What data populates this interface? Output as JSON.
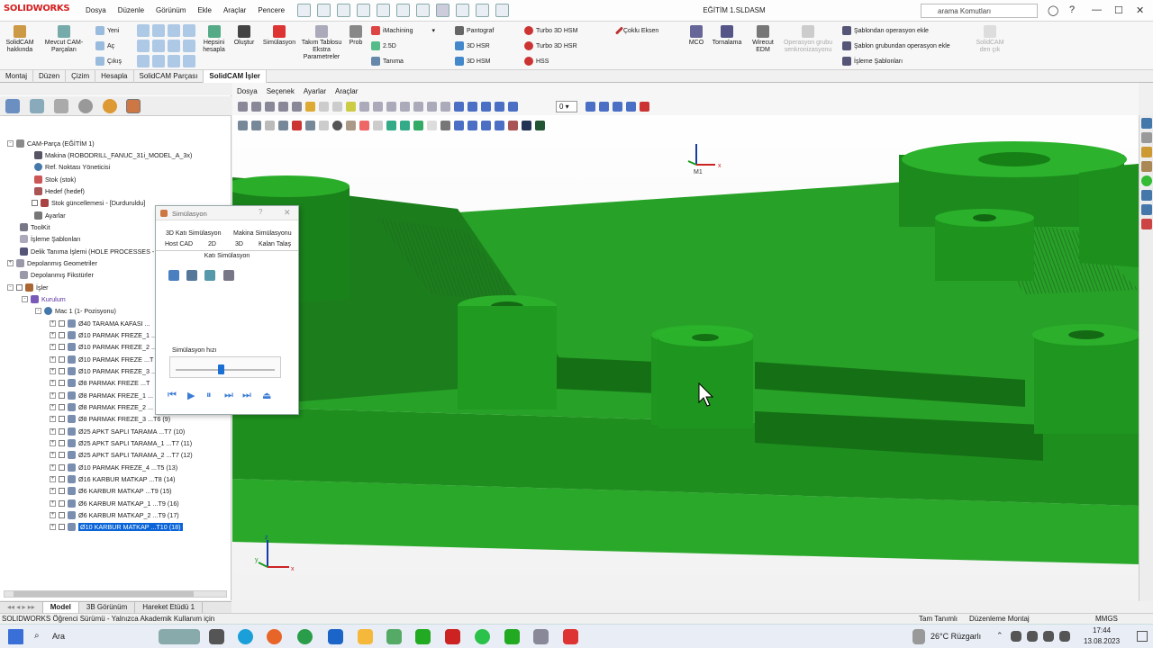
{
  "app": {
    "logo": "SOLIDWORKS",
    "doc_title": "EĞİTİM 1.SLDASM"
  },
  "menu": [
    "Dosya",
    "Düzenle",
    "Görünüm",
    "Ekle",
    "Araçlar",
    "Pencere"
  ],
  "search": {
    "placeholder": "arama Komutları"
  },
  "ribbon": {
    "solidcam_about": "SolidCAM hakkında",
    "mevcut": "Mevcut CAM-Parçaları",
    "yeni": "Yeni",
    "ac": "Aç",
    "cikis": "Çıkış",
    "hepsini": "Hepsini hesapla",
    "olustur": "Oluştur",
    "simulasyon": "Simülasyon",
    "takim": "Takım Tablosu Ekstra Parametreler",
    "prob": "Prob",
    "imachining": "iMachining",
    "d25": "2.5D",
    "tanima": "Tanıma",
    "pantograf": "Pantograf",
    "hsr3d": "3D HSR",
    "hsm3d": "3D HSM",
    "turbo_hsm": "Turbo 3D HSM",
    "turbo_hsr": "Turbo 3D HSR",
    "hss": "HSS",
    "coklu": "Çoklu Eksen",
    "mco": "MCO",
    "tornalama": "Tornalama",
    "wirecut": "Wirecut EDM",
    "sync": "Operasyon grubu senkronizasyonu",
    "sablondan": "Şablondan operasyon ekle",
    "sablon_grup": "Şablon grubundan operasyon ekle",
    "isleme_sablon": "İşleme Şablonları",
    "solidcam_ek": "SolidCAM den çık"
  },
  "tabs": [
    "Montaj",
    "Düzen",
    "Çizim",
    "Hesapla",
    "SolidCAM Parçası",
    "SolidCAM İşler"
  ],
  "view_menu": [
    "Dosya",
    "Seçenek",
    "Ayarlar",
    "Araçlar"
  ],
  "view_num": "0",
  "tree": [
    "CAM-Parça (EĞİTİM 1)",
    "Makina (ROBODRILL_FANUC_31i_MODEL_A_3x)",
    "Ref. Noktası Yöneticisi",
    "Stok (stok)",
    "Hedef (hedef)",
    "Stok güncellemesi - [Durduruldu]",
    "Ayarlar",
    "ToolKit",
    "İşleme Şablonları",
    "Delik Tanıma İşlemi (HOLE PROCESSES - SO",
    "Depolanmış Geometriler",
    "Depolanmış Fikstürler",
    "İşler",
    "Kurulum",
    "Mac 1 (1- Pozisyonu)",
    "Ø40 TARAMA KAFASI ...",
    "Ø10 PARMAK FREZE_1 ...",
    "Ø10 PARMAK FREZE_2 ...",
    "Ø10 PARMAK FREZE ...T",
    "Ø10 PARMAK FREZE_3 ...",
    "Ø8 PARMAK FREZE ...T",
    "Ø8 PARMAK FREZE_1 ...",
    "Ø8 PARMAK FREZE_2 ...",
    "Ø8 PARMAK FREZE_3 ...T6 (9)",
    "Ø25 APKT SAPLI TARAMA ...T7 (10)",
    "Ø25 APKT SAPLI TARAMA_1 ...T7 (11)",
    "Ø25 APKT SAPLI TARAMA_2 ...T7 (12)",
    "Ø10 PARMAK FREZE_4 ...T5 (13)",
    "Ø16 KARBUR MATKAP ...T8 (14)",
    "Ø6 KARBUR MATKAP ...T9 (15)",
    "Ø6 KARBUR MATKAP_1 ...T9 (16)",
    "Ø6 KARBUR MATKAP_2 ...T9 (17)",
    "Ø10 KARBUR MATKAP ...T10 (18)"
  ],
  "bottom_tabs": [
    "Model",
    "3B Görünüm",
    "Hareket Etüdü 1"
  ],
  "status": {
    "left": "SOLIDWORKS Öğrenci Sürümü - Yalnızca Akademik Kullanım için",
    "mid1": "Tam Tanımlı",
    "mid2": "Düzenleme Montaj",
    "units": "MMGS"
  },
  "dialog": {
    "title": "Simülasyon",
    "tab_3dkati": "3D Katı Simülasyon",
    "tab_makina": "Makina Simülasyonu",
    "tab_host": "Host CAD",
    "tab_2d": "2D",
    "tab_3d": "3D",
    "tab_kalan": "Kalan Talaş",
    "tab_kati": "Katı Simülasyon",
    "speed_label": "Simülasyon hızı",
    "speed": 0.45
  },
  "triad": {
    "x": "x",
    "y": "y",
    "z": "z",
    "m1": "M1"
  },
  "taskbar": {
    "search": "Ara",
    "weather": "26°C  Rüzgarlı",
    "time": "17:44",
    "date": "13.08.2023"
  }
}
